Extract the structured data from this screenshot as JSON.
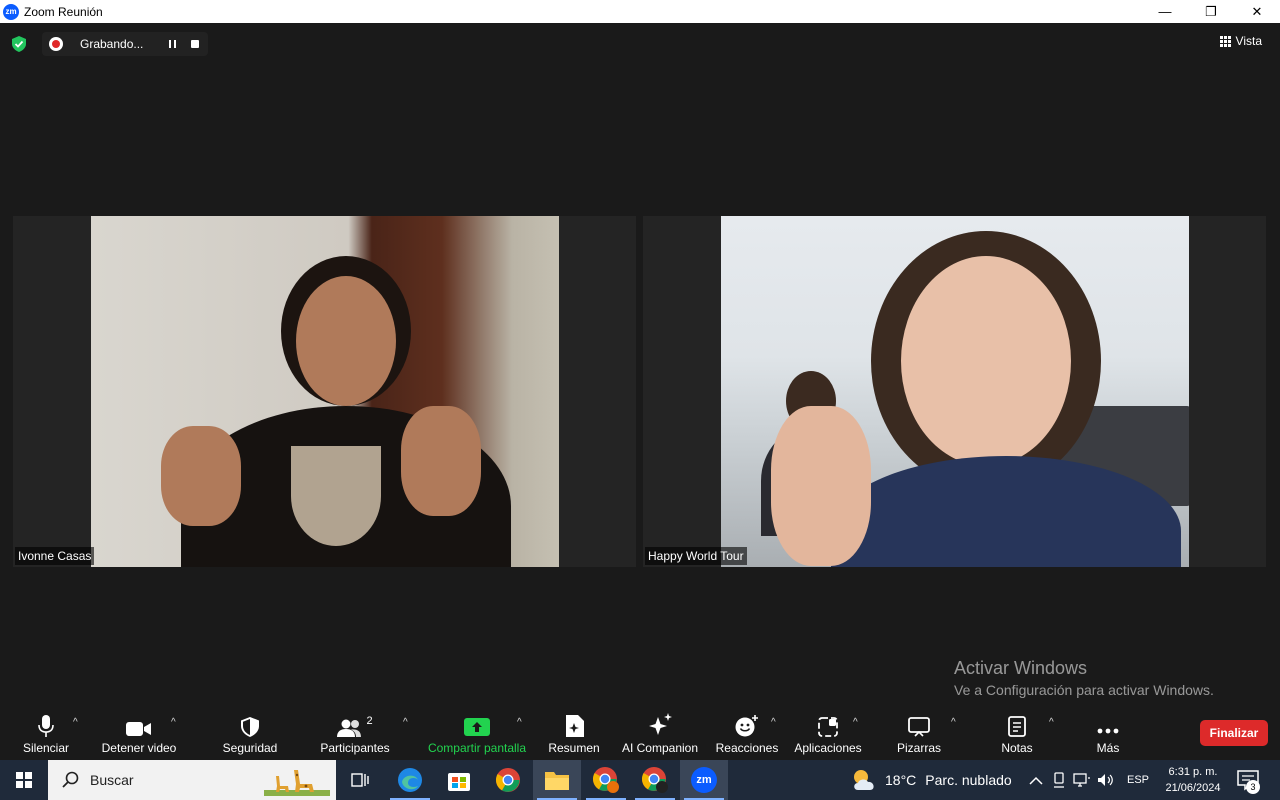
{
  "window": {
    "app_icon_text": "zm",
    "title": "Zoom Reunión",
    "controls": {
      "minimize": "—",
      "restore": "❐",
      "close": "✕"
    }
  },
  "topbar": {
    "recording_label": "Grabando...",
    "view_label": "Vista"
  },
  "participants": [
    {
      "name": "Ivonne Casas"
    },
    {
      "name": "Happy World Tour"
    }
  ],
  "watermark": {
    "title": "Activar Windows",
    "subtitle": "Ve a Configuración para activar Windows."
  },
  "toolbar": {
    "mute": "Silenciar",
    "stop_video": "Detener video",
    "security": "Seguridad",
    "participants": "Participantes",
    "participants_count": "2",
    "share_screen": "Compartir pantalla",
    "summary": "Resumen",
    "ai_companion": "AI Companion",
    "reactions": "Reacciones",
    "apps": "Aplicaciones",
    "whiteboards": "Pizarras",
    "notes": "Notas",
    "more": "Más",
    "end": "Finalizar"
  },
  "taskbar": {
    "search_placeholder": "Buscar",
    "weather_temp": "18°C",
    "weather_desc": "Parc. nublado",
    "language": "ESP",
    "time": "6:31 p. m.",
    "date": "21/06/2024",
    "notification_count": "3",
    "zoom_icon_text": "zm"
  },
  "colors": {
    "accent_green": "#22d34f",
    "end_red": "#dd2a2a",
    "zoom_blue": "#0b5cff"
  }
}
